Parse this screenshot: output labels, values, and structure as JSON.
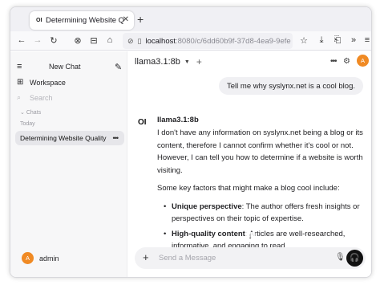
{
  "browser": {
    "tab": {
      "favicon": "OI",
      "title": "Determining Website Qua"
    },
    "url_host": "localhost",
    "url_rest": ":8080/c/6dd60b9f-37d8-4ea9-9efe"
  },
  "sidebar": {
    "new_chat": "New Chat",
    "workspace": "Workspace",
    "search_placeholder": "Search",
    "section_chats": "Chats",
    "section_today": "Today",
    "chat_item": "Determining Website Quality",
    "user_initial": "A",
    "user_name": "admin"
  },
  "header": {
    "model": "llama3.1:8b",
    "user_initial": "A"
  },
  "messages": {
    "user": "Tell me why syslynx.net is a cool blog.",
    "ai_logo": "OI",
    "ai_name": "llama3.1:8b",
    "p1": "I don't have any information on syslynx.net being a blog or its content, therefore I cannot confirm whether it's cool or not. However, I can tell you how to determine if a website is worth visiting.",
    "p2": "Some key factors that might make a blog cool include:",
    "b1_title": "Unique perspective",
    "b1_text": ": The author offers fresh insights or perspectives on their topic of expertise.",
    "b2_title": "High-quality content",
    "b2_text": ": Articles are well-researched, informative, and engaging to read."
  },
  "input": {
    "placeholder": "Send a Message"
  },
  "icons": [
    "menu-icon",
    "compose-icon",
    "grid-icon",
    "search-icon",
    "chevron-down-icon",
    "plus-icon",
    "more-icon",
    "settings-icon",
    "mic-icon",
    "headphones-icon",
    "arrow-down-icon"
  ]
}
